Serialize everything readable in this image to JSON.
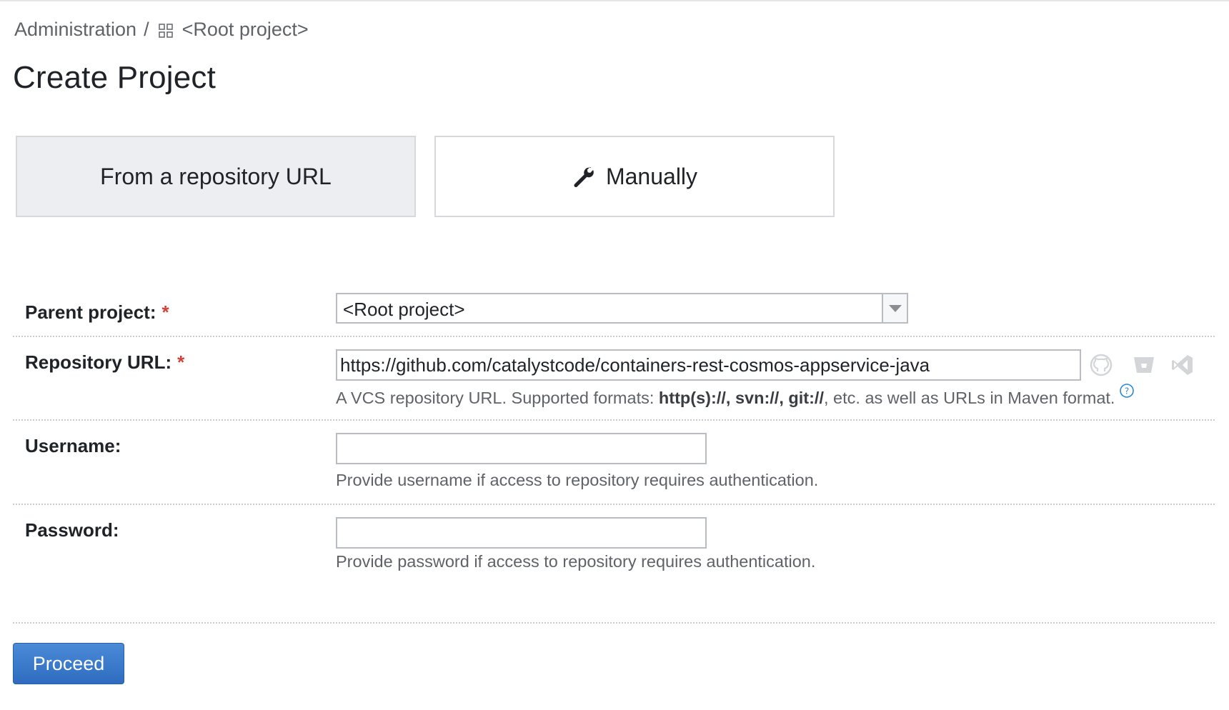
{
  "breadcrumb": {
    "admin": "Administration",
    "separator": "/",
    "project": "<Root project>"
  },
  "title": "Create Project",
  "mode": {
    "from_url": "From a repository URL",
    "manually": "Manually",
    "selected": "from_url"
  },
  "form": {
    "parent": {
      "label": "Parent project:",
      "required_mark": "*",
      "value": "<Root project>"
    },
    "repo_url": {
      "label": "Repository URL:",
      "required_mark": "*",
      "value": "https://github.com/catalystcode/containers-rest-cosmos-appservice-java",
      "hint_prefix": "A VCS repository URL. Supported formats: ",
      "hint_formats": "http(s)://, svn://, git://",
      "hint_suffix": ", etc. as well as URLs in Maven format.",
      "icons": [
        "github-icon",
        "bitbucket-icon",
        "visual-studio-icon",
        "help-icon"
      ]
    },
    "username": {
      "label": "Username:",
      "value": "",
      "hint": "Provide username if access to repository requires authentication."
    },
    "password": {
      "label": "Password:",
      "value": "",
      "hint": "Provide password if access to repository requires authentication."
    }
  },
  "actions": {
    "proceed": "Proceed"
  },
  "colors": {
    "primary_button": "#2f6cc0",
    "required": "#d43f3a",
    "selected_tab": "#eceef1",
    "help": "#2a8ad6"
  }
}
